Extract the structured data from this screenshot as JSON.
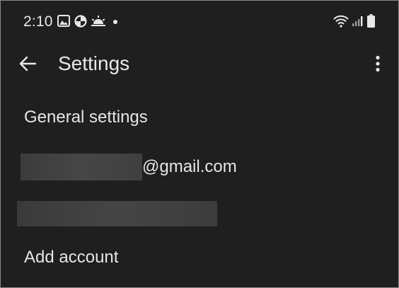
{
  "status_bar": {
    "time": "2:10",
    "icons": [
      "image-icon",
      "data-saver-icon",
      "weather-sunrise-icon",
      "notification-dot",
      "wifi-icon",
      "signal-icon",
      "battery-icon"
    ]
  },
  "app_bar": {
    "title": "Settings",
    "back_icon": "arrow-left-icon",
    "menu_icon": "more-vert-icon"
  },
  "list": {
    "general_settings": "General settings",
    "account_1_suffix": "@gmail.com",
    "add_account": "Add account"
  },
  "colors": {
    "background": "#1f1f1f",
    "text": "#e6e6e6",
    "redaction": "#424242"
  }
}
